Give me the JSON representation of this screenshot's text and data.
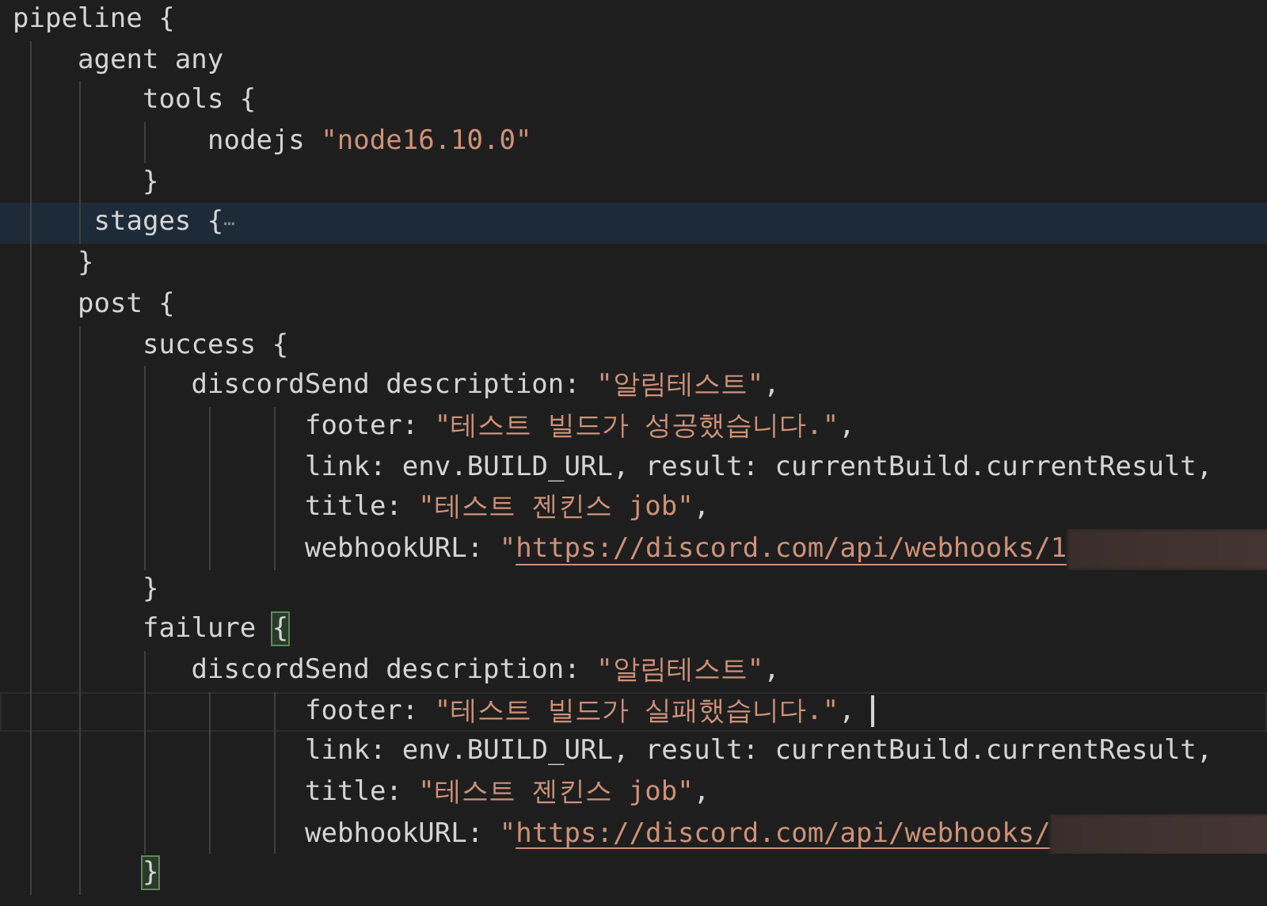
{
  "editor": {
    "lines": [
      {
        "kind": "top",
        "highlighted": false,
        "current": false,
        "tokens": [
          {
            "kind": "plain",
            "text": "pipeline {"
          }
        ]
      },
      {
        "kind": "block",
        "highlighted": false,
        "current": false,
        "tokens": [
          {
            "kind": "plain",
            "text": "agent any"
          }
        ]
      },
      {
        "kind": "nested",
        "highlighted": false,
        "current": false,
        "tokens": [
          {
            "kind": "plain",
            "text": "tools {"
          }
        ]
      },
      {
        "kind": "inner",
        "highlighted": false,
        "current": false,
        "tokens": [
          {
            "kind": "plain",
            "text": "nodejs"
          },
          {
            "kind": "string",
            "text": "\"node16.10.0\""
          }
        ]
      },
      {
        "kind": "nested",
        "highlighted": false,
        "current": false,
        "tokens": [
          {
            "kind": "plain",
            "text": "}"
          }
        ]
      },
      {
        "kind": "folded",
        "highlighted": true,
        "current": false,
        "tokens": [
          {
            "kind": "plain",
            "text": "stages {"
          },
          {
            "kind": "fold",
            "text": "⋯"
          }
        ]
      },
      {
        "kind": "block",
        "highlighted": false,
        "current": false,
        "tokens": [
          {
            "kind": "plain",
            "text": "}"
          }
        ]
      },
      {
        "kind": "block",
        "highlighted": false,
        "current": false,
        "tokens": [
          {
            "kind": "plain",
            "text": "post {"
          }
        ]
      },
      {
        "kind": "nested",
        "highlighted": false,
        "current": false,
        "tokens": [
          {
            "kind": "plain",
            "text": "success {"
          }
        ]
      },
      {
        "kind": "call",
        "highlighted": false,
        "current": false,
        "tokens": [
          {
            "kind": "plain",
            "text": "discordSend description:"
          },
          {
            "kind": "string",
            "text": "\"알림테스트\""
          },
          {
            "kind": "punct",
            "text": ","
          }
        ]
      },
      {
        "kind": "args",
        "highlighted": false,
        "current": false,
        "tokens": [
          {
            "kind": "plain",
            "text": "footer:"
          },
          {
            "kind": "string",
            "text": "\"테스트 빌드가 성공했습니다.\""
          },
          {
            "kind": "punct",
            "text": ","
          }
        ]
      },
      {
        "kind": "args",
        "highlighted": false,
        "current": false,
        "tokens": [
          {
            "kind": "plain",
            "text": "link: env.BUILD_URL, result: currentBuild.currentResult,"
          }
        ]
      },
      {
        "kind": "args",
        "highlighted": false,
        "current": false,
        "tokens": [
          {
            "kind": "plain",
            "text": "title:"
          },
          {
            "kind": "string",
            "text": "\"테스트 젠킨스 job\""
          },
          {
            "kind": "punct",
            "text": ","
          }
        ]
      },
      {
        "kind": "args",
        "highlighted": false,
        "current": false,
        "redacted": true,
        "tokens": [
          {
            "kind": "plain",
            "text": "webhookURL:"
          },
          {
            "kind": "string",
            "text": "\""
          },
          {
            "kind": "link",
            "text": "https://discord.com/api/webhooks/1"
          }
        ]
      },
      {
        "kind": "nested",
        "highlighted": false,
        "current": false,
        "tokens": [
          {
            "kind": "plain",
            "text": "}"
          }
        ]
      },
      {
        "kind": "nested",
        "highlighted": false,
        "current": false,
        "tokens": [
          {
            "kind": "plain",
            "text": "failure"
          },
          {
            "kind": "bracket_match",
            "text": "{"
          }
        ]
      },
      {
        "kind": "call",
        "highlighted": false,
        "current": false,
        "tokens": [
          {
            "kind": "plain",
            "text": "discordSend description:"
          },
          {
            "kind": "string",
            "text": "\"알림테스트\""
          },
          {
            "kind": "punct",
            "text": ","
          }
        ]
      },
      {
        "kind": "args",
        "highlighted": false,
        "current": true,
        "tokens": [
          {
            "kind": "plain",
            "text": "footer:"
          },
          {
            "kind": "string",
            "text": "\"테스트 빌드가 실패했습니다.\""
          },
          {
            "kind": "punct",
            "text": ","
          }
        ]
      },
      {
        "kind": "args",
        "highlighted": false,
        "current": false,
        "tokens": [
          {
            "kind": "plain",
            "text": "link: env.BUILD_URL, result: currentBuild.currentResult,"
          }
        ]
      },
      {
        "kind": "args",
        "highlighted": false,
        "current": false,
        "tokens": [
          {
            "kind": "plain",
            "text": "title:"
          },
          {
            "kind": "string",
            "text": "\"테스트 젠킨스 job\""
          },
          {
            "kind": "punct",
            "text": ","
          }
        ]
      },
      {
        "kind": "args",
        "highlighted": false,
        "current": false,
        "redacted": true,
        "tokens": [
          {
            "kind": "plain",
            "text": "webhookURL:"
          },
          {
            "kind": "string",
            "text": "\""
          },
          {
            "kind": "link",
            "text": "https://discord.com/api/webhooks/"
          }
        ]
      },
      {
        "kind": "nested",
        "highlighted": false,
        "current": false,
        "tokens": [
          {
            "kind": "bracket_match",
            "text": "}"
          }
        ]
      }
    ]
  }
}
